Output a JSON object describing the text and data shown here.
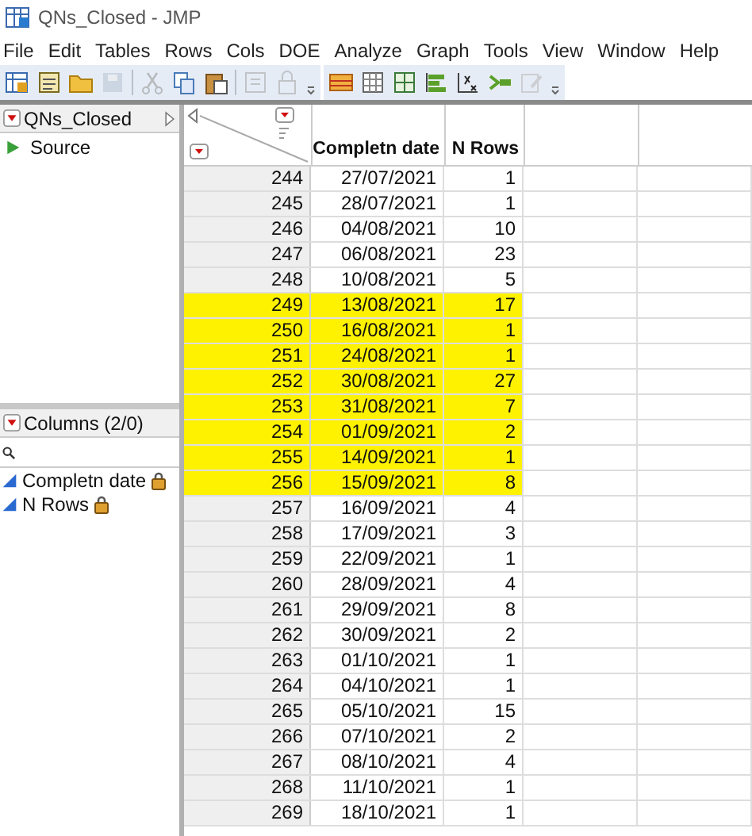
{
  "window": {
    "title": "QNs_Closed - JMP"
  },
  "menu": [
    "File",
    "Edit",
    "Tables",
    "Rows",
    "Cols",
    "DOE",
    "Analyze",
    "Graph",
    "Tools",
    "View",
    "Window",
    "Help"
  ],
  "tables_panel": {
    "title": "QNs_Closed",
    "items": [
      {
        "label": "Source"
      }
    ]
  },
  "columns_panel": {
    "title": "Columns (2/0)",
    "columns": [
      {
        "name": "Completn date",
        "locked": true
      },
      {
        "name": "N Rows",
        "locked": true
      }
    ]
  },
  "table": {
    "columns": [
      "Completn date",
      "N Rows"
    ],
    "rows": [
      {
        "row": "244",
        "cells": [
          "27/07/2021",
          "1"
        ],
        "highlighted": false
      },
      {
        "row": "245",
        "cells": [
          "28/07/2021",
          "1"
        ],
        "highlighted": false
      },
      {
        "row": "246",
        "cells": [
          "04/08/2021",
          "10"
        ],
        "highlighted": false
      },
      {
        "row": "247",
        "cells": [
          "06/08/2021",
          "23"
        ],
        "highlighted": false
      },
      {
        "row": "248",
        "cells": [
          "10/08/2021",
          "5"
        ],
        "highlighted": false
      },
      {
        "row": "249",
        "cells": [
          "13/08/2021",
          "17"
        ],
        "highlighted": true
      },
      {
        "row": "250",
        "cells": [
          "16/08/2021",
          "1"
        ],
        "highlighted": true
      },
      {
        "row": "251",
        "cells": [
          "24/08/2021",
          "1"
        ],
        "highlighted": true
      },
      {
        "row": "252",
        "cells": [
          "30/08/2021",
          "27"
        ],
        "highlighted": true
      },
      {
        "row": "253",
        "cells": [
          "31/08/2021",
          "7"
        ],
        "highlighted": true
      },
      {
        "row": "254",
        "cells": [
          "01/09/2021",
          "2"
        ],
        "highlighted": true
      },
      {
        "row": "255",
        "cells": [
          "14/09/2021",
          "1"
        ],
        "highlighted": true
      },
      {
        "row": "256",
        "cells": [
          "15/09/2021",
          "8"
        ],
        "highlighted": true
      },
      {
        "row": "257",
        "cells": [
          "16/09/2021",
          "4"
        ],
        "highlighted": false
      },
      {
        "row": "258",
        "cells": [
          "17/09/2021",
          "3"
        ],
        "highlighted": false
      },
      {
        "row": "259",
        "cells": [
          "22/09/2021",
          "1"
        ],
        "highlighted": false
      },
      {
        "row": "260",
        "cells": [
          "28/09/2021",
          "4"
        ],
        "highlighted": false
      },
      {
        "row": "261",
        "cells": [
          "29/09/2021",
          "8"
        ],
        "highlighted": false
      },
      {
        "row": "262",
        "cells": [
          "30/09/2021",
          "2"
        ],
        "highlighted": false
      },
      {
        "row": "263",
        "cells": [
          "01/10/2021",
          "1"
        ],
        "highlighted": false
      },
      {
        "row": "264",
        "cells": [
          "04/10/2021",
          "1"
        ],
        "highlighted": false
      },
      {
        "row": "265",
        "cells": [
          "05/10/2021",
          "15"
        ],
        "highlighted": false
      },
      {
        "row": "266",
        "cells": [
          "07/10/2021",
          "2"
        ],
        "highlighted": false
      },
      {
        "row": "267",
        "cells": [
          "08/10/2021",
          "4"
        ],
        "highlighted": false
      },
      {
        "row": "268",
        "cells": [
          "11/10/2021",
          "1"
        ],
        "highlighted": false
      },
      {
        "row": "269",
        "cells": [
          "18/10/2021",
          "1"
        ],
        "highlighted": false
      }
    ]
  }
}
